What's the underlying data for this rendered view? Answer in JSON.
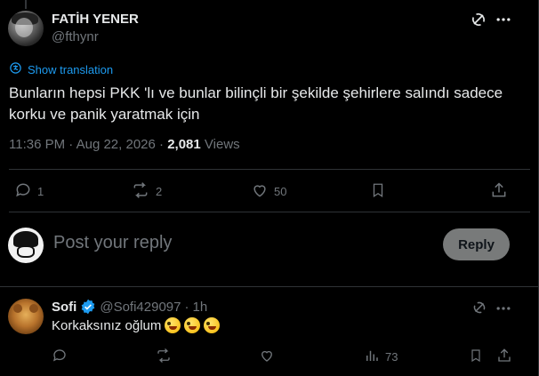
{
  "tweet": {
    "author_name": "FATİH YENER",
    "author_handle": "@fthynr",
    "translate_label": "Show translation",
    "text": "Bunların hepsi PKK 'lı ve bunlar bilinçli bir şekilde şehirlere salındı sadece korku ve panik yaratmak için",
    "time": "11:36 PM",
    "date": "Aug 22, 2026",
    "views_count": "2,081",
    "views_label": "Views",
    "actions": {
      "replies": "1",
      "reposts": "2",
      "likes": "50"
    }
  },
  "composer": {
    "placeholder": "Post your reply",
    "button_label": "Reply"
  },
  "reply": {
    "author_name": "Sofi",
    "author_handle": "@Sofi429097",
    "time": "1h",
    "text": "Korkaksınız oğlum",
    "views": "73",
    "emojis": [
      "zany-face",
      "zany-face",
      "zany-face"
    ]
  },
  "colors": {
    "background": "#000000",
    "text": "#e7e9ea",
    "muted": "#71767b",
    "accent": "#1d9bf0",
    "divider": "#2f3336",
    "reply_button_bg": "#787a7a"
  },
  "icons": {
    "grok": "grok-icon",
    "more": "more-icon",
    "translate": "translate-icon",
    "reply": "reply-icon",
    "repost": "repost-icon",
    "like": "heart-icon",
    "bookmark": "bookmark-icon",
    "share": "share-icon",
    "views": "views-icon",
    "verified": "verified-badge-icon"
  }
}
